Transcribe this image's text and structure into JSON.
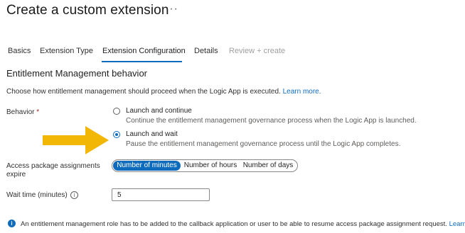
{
  "header": {
    "title": "Create a custom extension",
    "more_label": "···"
  },
  "tabs": [
    {
      "label": "Basics",
      "state": "normal"
    },
    {
      "label": "Extension Type",
      "state": "normal"
    },
    {
      "label": "Extension Configuration",
      "state": "active"
    },
    {
      "label": "Details",
      "state": "normal"
    },
    {
      "label": "Review + create",
      "state": "disabled"
    }
  ],
  "section": {
    "title": "Entitlement Management behavior",
    "description": "Choose how entitlement management should proceed when the Logic App is executed.",
    "learn_more": "Learn more."
  },
  "behavior": {
    "label": "Behavior",
    "required_mark": "*",
    "options": [
      {
        "title": "Launch and continue",
        "subtitle": "Continue the entitlement management governance process when the Logic App is launched.",
        "selected": false
      },
      {
        "title": "Launch and wait",
        "subtitle": "Pause the entitlement management governance process until the Logic App completes.",
        "selected": true
      }
    ]
  },
  "expire": {
    "label_line1": "Access package assignments",
    "label_line2": "expire",
    "options": [
      "Number of minutes",
      "Number of hours",
      "Number of days"
    ],
    "selected_index": 0
  },
  "wait_time": {
    "label": "Wait time (minutes)",
    "value": "5"
  },
  "info_note": {
    "text": "An entitlement management role has to be added to the callback application or user to be able to resume access package assignment request.",
    "learn_more": "Learn more."
  },
  "colors": {
    "accent": "#0f6cbd",
    "annotation_arrow": "#f2b705"
  },
  "icons": {
    "info": "info-icon",
    "info_filled": "info-filled-icon",
    "arrow": "annotation-arrow-icon"
  }
}
